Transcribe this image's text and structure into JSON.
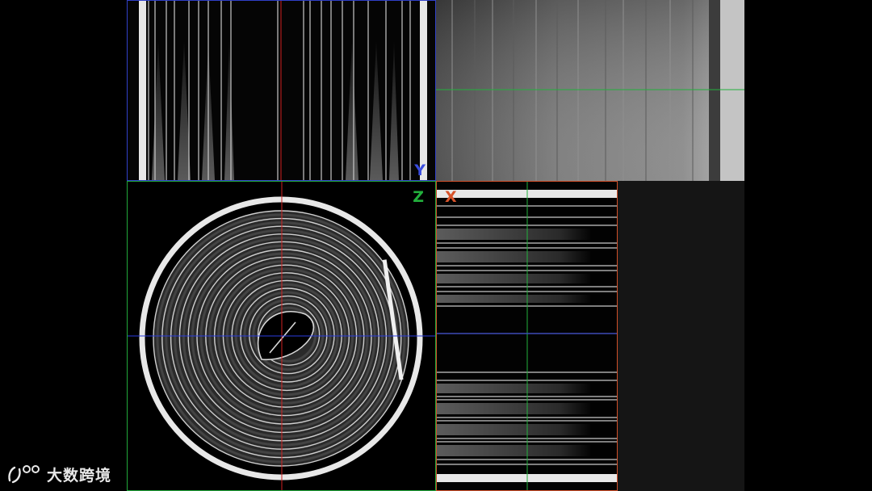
{
  "viewer": {
    "views": {
      "y": {
        "axis_label": "Y",
        "color": "#3a4de0"
      },
      "z": {
        "axis_label": "Z",
        "color": "#22b03c"
      },
      "x": {
        "axis_label": "X",
        "color": "#d8532a"
      }
    },
    "crosshair_colors": {
      "red": "#d02020",
      "green": "#22b03c",
      "blue": "#2a3ce0"
    }
  },
  "watermark": {
    "text": "大数跨境",
    "icon": "brand-logo-icon"
  }
}
